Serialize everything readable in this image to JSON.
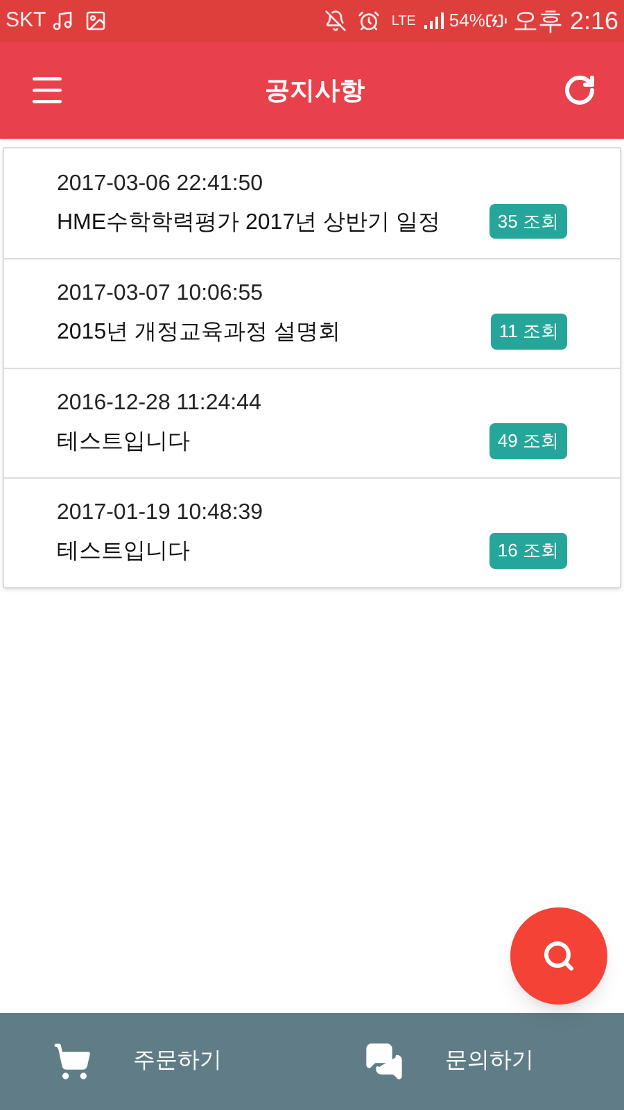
{
  "status_bar": {
    "carrier": "SKT",
    "network": "LTE",
    "battery": "54%",
    "time": "오후 2:16"
  },
  "app_bar": {
    "title": "공지사항"
  },
  "notices": [
    {
      "date": "2017-03-06 22:41:50",
      "title": "HME수학학력평가 2017년 상반기 일정",
      "views": "35 조회"
    },
    {
      "date": "2017-03-07 10:06:55",
      "title": "2015년 개정교육과정 설명회",
      "views": "11 조회"
    },
    {
      "date": "2016-12-28 11:24:44",
      "title": "테스트입니다",
      "views": "49 조회"
    },
    {
      "date": "2017-01-19 10:48:39",
      "title": "테스트입니다",
      "views": "16 조회"
    }
  ],
  "bottom_nav": [
    {
      "kind": "cart",
      "label": "주문하기"
    },
    {
      "kind": "chat",
      "label": "문의하기"
    }
  ]
}
